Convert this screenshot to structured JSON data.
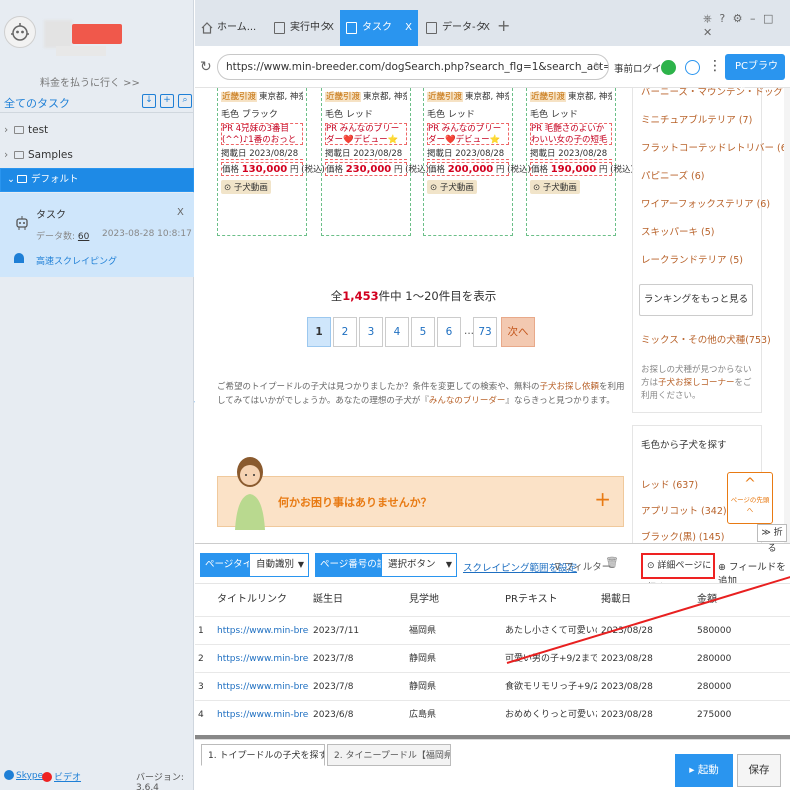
{
  "sidebar": {
    "pay_label": "料金を払うに行く >>",
    "tasks_title": "全てのタスク",
    "tree": [
      {
        "label": "test"
      },
      {
        "label": "Samples"
      },
      {
        "label": "デフォルト"
      }
    ],
    "task": {
      "name": "タスク",
      "data_label": "データ数:",
      "data_count": "60",
      "time": "2023-08-28 10:8:17",
      "speed": "高速スクレイピング"
    },
    "footer": {
      "skype": "Skype",
      "video": "ビデオ",
      "version": "バージョン: 3.6.4"
    }
  },
  "tabs": [
    {
      "label": "ホーム..."
    },
    {
      "label": "実行中タス..."
    },
    {
      "label": "タスク"
    },
    {
      "label": "データ-タス..."
    }
  ],
  "browser": {
    "url": "https://www.min-breeder.com/dogSearch.php?search_flg=1&search_act=search&search_p...",
    "login": "事前ログイン",
    "pc_label": "PCブラウザ"
  },
  "cards": [
    {
      "badge": "近畿引渡",
      "loc": "東京都, 神奈川県...",
      "color": "毛色 ブラック",
      "pr": "PR 4兄妹の3番目(^^)♪1番のおっとりさん❤️",
      "date": "掲載日 2023/08/28",
      "price_pre": "価格 ",
      "price": "130,000",
      "price_post": " 円 (税込)",
      "movie": "子犬動画"
    },
    {
      "badge": "近畿引渡",
      "loc": "東京都, 神奈川県...",
      "color": "毛色 レッド",
      "pr": "PR みんなのブリーダー❤️デビュー⭐特別記念価格🌟",
      "date": "掲載日 2023/08/28",
      "price_pre": "価格 ",
      "price": "230,000",
      "price_post": " 円 (税込)",
      "movie": ""
    },
    {
      "badge": "近畿引渡",
      "loc": "東京都, 神奈川県...",
      "color": "毛色 レッド",
      "pr": "PR みんなのブリーダー❤️デビュー⭐特別記念価格🌟",
      "date": "掲載日 2023/08/28",
      "price_pre": "価格 ",
      "price": "200,000",
      "price_post": " 円 (税込)",
      "movie": "子犬動画"
    },
    {
      "badge": "近畿引渡",
      "loc": "東京都, 神奈川県...",
      "color": "毛色 レッド",
      "pr": "PR 毛艶さのよいかわいい女の子の短毛BOYです。",
      "date": "掲載日 2023/08/28",
      "price_pre": "価格 ",
      "price": "190,000",
      "price_post": " 円 (税込)",
      "movie": "子犬動画"
    }
  ],
  "right_links": [
    "バーニーズ・マウンテン・ドッグ (7)",
    "ミニチュアブルテリア (7)",
    "フラットコーテッドレトリバー (6)",
    "パピニーズ (6)",
    "ワイアーフォックステリア (6)",
    "スキッパーキ (5)",
    "レークランドテリア (5)"
  ],
  "rank_btn": "ランキングをもっと見る",
  "mix": "ミックス・その他の犬種(753)",
  "not_found": "お探しの犬種が見つからない方は",
  "not_found_link": "子犬お探しコーナー",
  "not_found_post": "をご利用ください。",
  "color_title": "毛色から子犬を探す",
  "color_links": [
    "レッド (637)",
    "アプリコット (342)",
    "ブラック(黒) (145)"
  ],
  "count": {
    "pre": "全",
    "num": "1,453",
    "post": "件中  1～20件目を表示"
  },
  "pages": [
    "1",
    "2",
    "3",
    "4",
    "5",
    "6",
    "...",
    "73",
    "次へ"
  ],
  "desc": {
    "a": "ご希望のトイプードルの子犬は見つかりましたか？条件を変更しての検索や、無料の",
    "link": "子犬お探し依頼",
    "b": "を利用してみてはいかがでしょうか。あなたの理想の子犬が『",
    "link2": "みんなのブリーダー",
    "c": "』ならきっと見つかります。"
  },
  "help": "何かお困り事はありませんか？",
  "totop": "ページの先頭へ",
  "toolbar": {
    "fold": "≫ 折る",
    "page_type": "ページタイプ",
    "page_type_val": "自動識別",
    "page_num": "ページ番号の設定",
    "page_num_val": "選択ボタン",
    "scrape_range": "スクレイピング範囲を設定",
    "filter": "フィルター",
    "detail": "詳細ページに行く",
    "add_field": "フィールドを追加"
  },
  "table": {
    "headers": [
      "タイトルリンク",
      "誕生日",
      "見学地",
      "PRテキスト",
      "掲載日",
      "金額"
    ],
    "rows": [
      [
        "1",
        "https://www.min-breeder.co...",
        "2023/7/11",
        "福岡県",
        "あたし小さくて可愛いの❤️...",
        "2023/08/28",
        "580000"
      ],
      [
        "2",
        "https://www.min-breeder.co...",
        "2023/7/8",
        "静岡県",
        "可愛い男の子+9/2までの即...",
        "2023/08/28",
        "280000"
      ],
      [
        "3",
        "https://www.min-breeder.co...",
        "2023/7/8",
        "静岡県",
        "食欲モリモリっ子+9/2まで...",
        "2023/08/28",
        "280000"
      ],
      [
        "4",
        "https://www.min-breeder.co...",
        "2023/6/8",
        "広島県",
        "おめめくりっと可愛いお風♪...",
        "2023/08/28",
        "275000"
      ]
    ]
  },
  "bottom_tabs": [
    "1. トイプードルの子犬を探す | ブ...",
    "2. タイニープードル【福岡県・女..."
  ],
  "start": "起動",
  "save": "保存",
  "colors": {
    "accent": "#2a95ef",
    "price": "#d2001f",
    "orange": "#e87a13",
    "arrow": "#e82020"
  }
}
